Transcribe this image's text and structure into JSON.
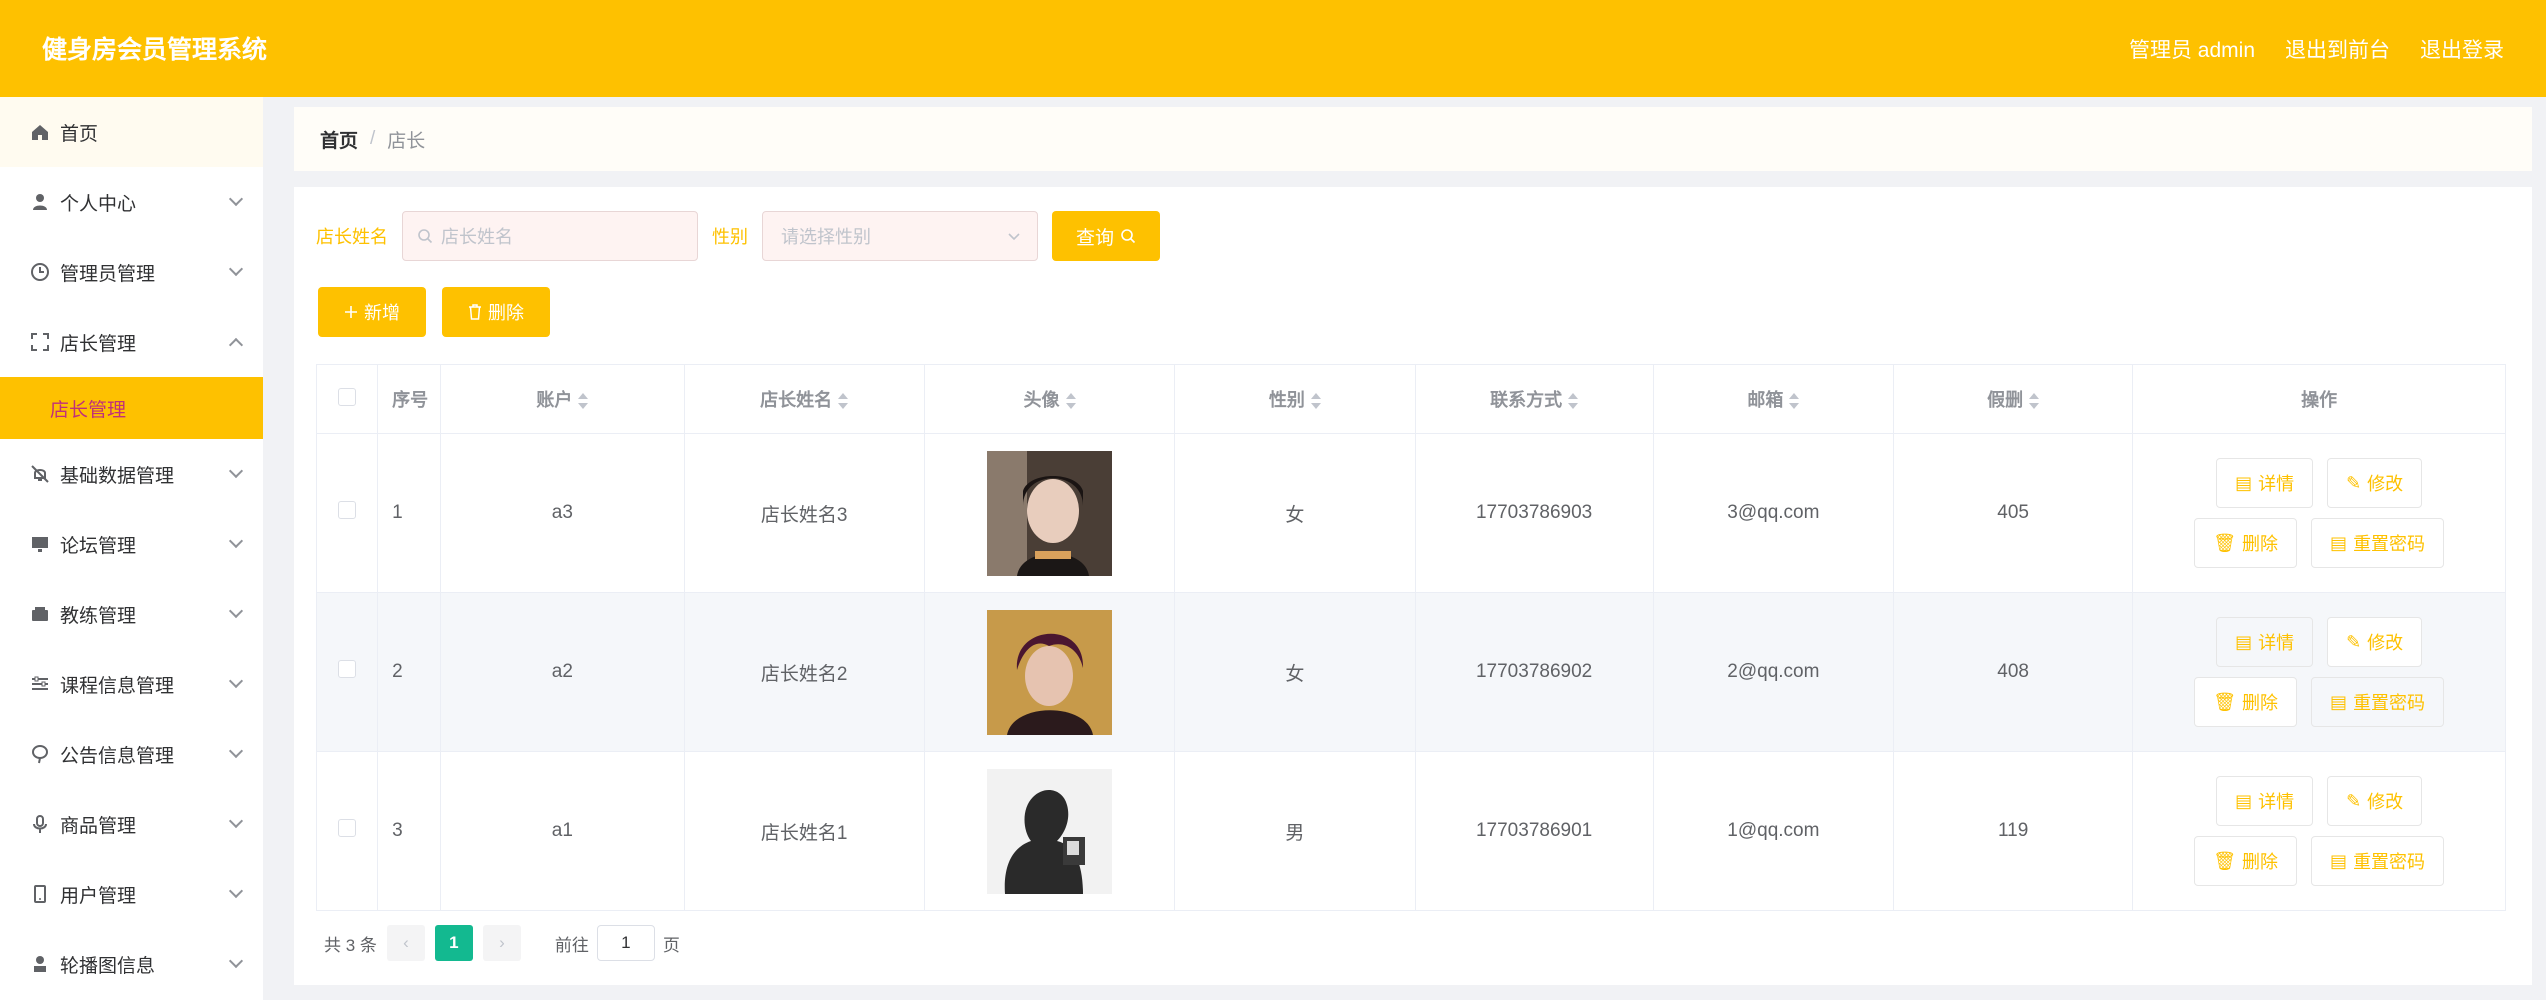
{
  "app": {
    "title": "健身房会员管理系统"
  },
  "topbar": {
    "admin_label": "管理员 admin",
    "to_front": "退出到前台",
    "logout": "退出登录"
  },
  "sidebar": {
    "items": [
      {
        "label": "首页",
        "icon": "home-icon"
      },
      {
        "label": "个人中心",
        "icon": "user-icon"
      },
      {
        "label": "管理员管理",
        "icon": "clock-icon"
      },
      {
        "label": "店长管理",
        "icon": "crop-icon"
      },
      {
        "label": "基础数据管理",
        "icon": "bell-off-icon"
      },
      {
        "label": "论坛管理",
        "icon": "monitor-icon"
      },
      {
        "label": "教练管理",
        "icon": "wallet-icon"
      },
      {
        "label": "课程信息管理",
        "icon": "sliders-icon"
      },
      {
        "label": "公告信息管理",
        "icon": "balloon-icon"
      },
      {
        "label": "商品管理",
        "icon": "microphone-icon"
      },
      {
        "label": "用户管理",
        "icon": "mobile-icon"
      },
      {
        "label": "轮播图信息",
        "icon": "person-icon"
      }
    ],
    "submenu_active": "店长管理"
  },
  "breadcrumb": {
    "home": "首页",
    "sep": "/",
    "current": "店长"
  },
  "search": {
    "name_label": "店长姓名",
    "name_placeholder": "店长姓名",
    "gender_label": "性别",
    "gender_placeholder": "请选择性别",
    "query_button": "查询"
  },
  "actions": {
    "add": "新增",
    "delete": "删除"
  },
  "table": {
    "headers": {
      "index": "序号",
      "account": "账户",
      "name": "店长姓名",
      "avatar": "头像",
      "gender": "性别",
      "phone": "联系方式",
      "email": "邮箱",
      "leave": "假删",
      "ops": "操作"
    },
    "rows": [
      {
        "index": "1",
        "account": "a3",
        "name": "店长姓名3",
        "gender": "女",
        "phone": "17703786903",
        "email": "3@qq.com",
        "leave": "405"
      },
      {
        "index": "2",
        "account": "a2",
        "name": "店长姓名2",
        "gender": "女",
        "phone": "17703786902",
        "email": "2@qq.com",
        "leave": "408"
      },
      {
        "index": "3",
        "account": "a1",
        "name": "店长姓名1",
        "gender": "男",
        "phone": "17703786901",
        "email": "1@qq.com",
        "leave": "119"
      }
    ],
    "ops": {
      "detail": "详情",
      "edit": "修改",
      "delete": "删除",
      "reset": "重置密码"
    }
  },
  "pager": {
    "total": "共 3 条",
    "current": "1",
    "goto_prefix": "前往",
    "goto_value": "1",
    "goto_suffix": "页"
  },
  "colors": {
    "accent": "#fec100",
    "page_active": "#13b990"
  }
}
